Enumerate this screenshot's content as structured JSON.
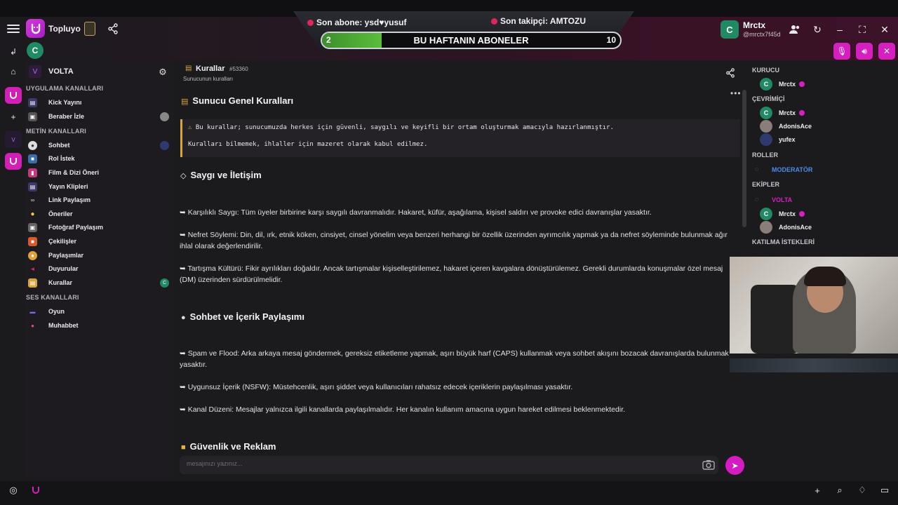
{
  "app": {
    "name": "Topluyo",
    "user_initial": "C"
  },
  "overlay": {
    "sub_label": "Son abone: ysd♥yusuf",
    "follow_label": "Son takipçi: AMTOZU",
    "goal_label": "BU HAFTANIN ABONELER",
    "goal_current": "2",
    "goal_max": "10",
    "goal_progress": 0.2
  },
  "user": {
    "name": "Mrctx",
    "handle": "@mrctx7f45d"
  },
  "server": {
    "name": "VOLTA",
    "icon_label": "VOLTA"
  },
  "sidebar": {
    "app_channels_title": "UYGULAMA KANALLARI",
    "text_channels_title": "METİN KANALLARI",
    "voice_channels_title": "SES KANALLARI",
    "app_channels": [
      "Kick Yayını",
      "Beraber İzle"
    ],
    "text_channels": [
      "Sohbet",
      "Rol İstek",
      "Film & Dizi Öneri",
      "Yayın Klipleri",
      "Link Paylaşım",
      "Öneriler",
      "Fotoğraf Paylaşım",
      "Çekilişler",
      "Paylaşımlar",
      "Duyurular",
      "Kurallar"
    ],
    "voice_channels": [
      "Oyun",
      "Muhabbet"
    ],
    "active_user_initial": "C"
  },
  "channel": {
    "title": "Kurallar",
    "id": "#53360",
    "description": "Sunucunun kuralları"
  },
  "content": {
    "section1_title": "Sunucu Genel Kuralları",
    "callout_line1": "Bu kurallar; sunucumuzda herkes için güvenli, saygılı ve keyifli bir ortam oluşturmak amacıyla hazırlanmıştır.",
    "callout_line2": "Kuralları bilmemek, ihlaller için mazeret olarak kabul edilmez.",
    "section2_title": "Saygı ve İletişim",
    "rule1": "➥ Karşılıklı Saygı: Tüm üyeler birbirine karşı saygılı davranmalıdır. Hakaret, küfür, aşağılama, kişisel saldırı ve provoke edici davranışlar yasaktır.",
    "rule2": "➥ Nefret Söylemi: Din, dil, ırk, etnik köken, cinsiyet, cinsel yönelim veya benzeri herhangi bir özellik üzerinden ayrımcılık yapmak ya da nefret söyleminde bulunmak ağır ihlal olarak değerlendirilir.",
    "rule3": "➥ Tartışma Kültürü: Fikir ayrılıkları doğaldır. Ancak tartışmalar kişiselleştirilemez, hakaret içeren kavgalara dönüştürülemez. Gerekli durumlarda konuşmalar özel mesaj (DM) üzerinden sürdürülmelidir.",
    "section3_title": "Sohbet ve İçerik Paylaşımı",
    "rule4": "➥ Spam ve Flood: Arka arkaya mesaj göndermek, gereksiz etiketleme yapmak, aşırı büyük harf (CAPS) kullanmak veya sohbet akışını bozacak davranışlarda bulunmak yasaktır.",
    "rule5": "➥ Uygunsuz İçerik (NSFW): Müstehcenlik, aşırı şiddet veya kullanıcıları rahatsız edecek içeriklerin paylaşılması yasaktır.",
    "rule6": "➥ Kanal Düzeni: Mesajlar yalnızca ilgili kanallarda paylaşılmalıdır. Her kanalın kullanım amacına uygun hareket edilmesi beklenmektedir.",
    "section4_title": "Güvenlik ve Reklam"
  },
  "input": {
    "placeholder": "mesajınızı yazınız..."
  },
  "members": {
    "founder_title": "KURUCU",
    "founder": "Mrctx",
    "online_title": "ÇEVRİMİÇİ",
    "online": [
      "Mrctx",
      "AdonisAce",
      "yufex"
    ],
    "roles_title": "ROLLER",
    "role_moderator": "MODERATÖR",
    "teams_title": "EKİPLER",
    "team_name": "VOLTA",
    "team_members": [
      "Mrctx",
      "AdonisAce"
    ],
    "requests_title": "KATILMA İSTEKLERİ"
  },
  "colors": {
    "accent": "#d61fbf",
    "moderator": "#4f8be8",
    "team": "#d61fbf",
    "avatar_green": "#1f8a63"
  }
}
